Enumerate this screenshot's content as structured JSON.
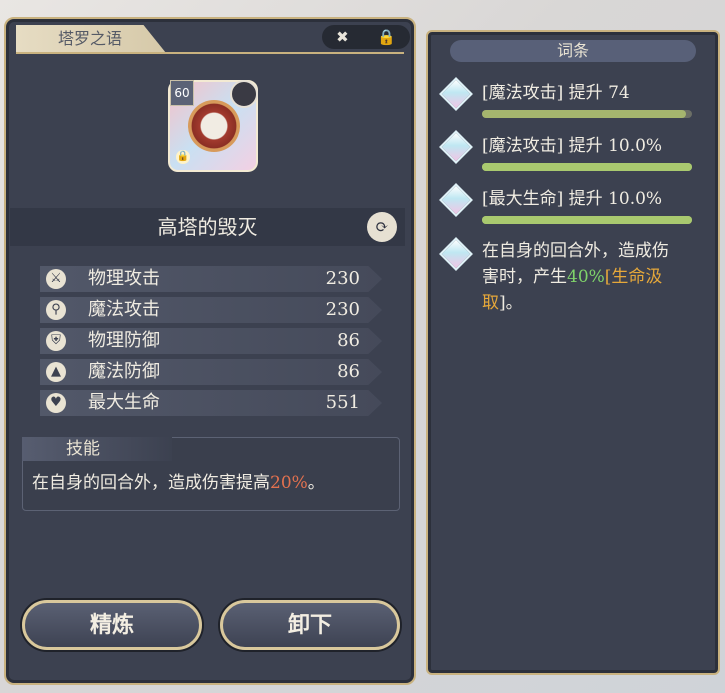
{
  "panel": {
    "title": "塔罗之语",
    "top_buttons": {
      "unequip_icon": "close-circle-icon",
      "lock_icon": "lock-icon"
    }
  },
  "item": {
    "level": "60",
    "name": "高塔的毁灭",
    "icon": "tarot-scroll-icon",
    "locked": true
  },
  "stats": [
    {
      "icon": "sword-icon",
      "label": "物理攻击",
      "value": "230"
    },
    {
      "icon": "wand-icon",
      "label": "魔法攻击",
      "value": "230"
    },
    {
      "icon": "shield-icon",
      "label": "物理防御",
      "value": "86"
    },
    {
      "icon": "wizard-hat-icon",
      "label": "魔法防御",
      "value": "86"
    },
    {
      "icon": "heart-icon",
      "label": "最大生命",
      "value": "551"
    }
  ],
  "skill": {
    "title": "技能",
    "text_pre": "在自身的回合外，造成伤害提高",
    "text_hl": "20%",
    "text_post": "。"
  },
  "buttons": {
    "refine": "精炼",
    "unequip": "卸下"
  },
  "affixes_panel": {
    "header": "词条",
    "affixes": [
      {
        "text": "[魔法攻击] 提升 74",
        "progress": 0.97
      },
      {
        "text": "[魔法攻击] 提升 10.0%",
        "progress": 1.0
      },
      {
        "text": "[最大生命] 提升 10.0%",
        "progress": 1.0
      }
    ],
    "skill_affix": {
      "line1": "在自身的回合外，造成伤",
      "line2_pre": "害时，产生",
      "line2_green": "40%",
      "line2_orange": "[生命汲",
      "line3_orange": "取",
      "line3_post": "]。"
    }
  },
  "colors": {
    "panel_bg": "#3c4150",
    "border_gold": "#c9b27f",
    "highlight_red": "#e2714f",
    "highlight_green": "#7fd36a",
    "highlight_orange": "#e6a83a"
  }
}
